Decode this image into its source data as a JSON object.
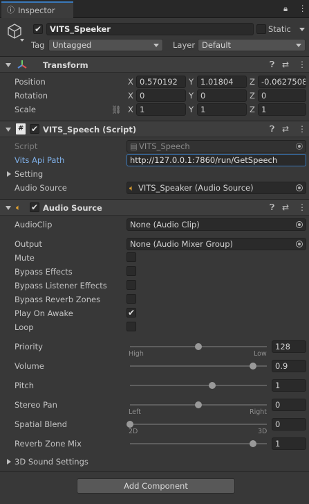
{
  "tab": {
    "label": "Inspector"
  },
  "object": {
    "name": "VITS_Speeker",
    "static_label": "Static",
    "tag_label": "Tag",
    "tag_value": "Untagged",
    "layer_label": "Layer",
    "layer_value": "Default"
  },
  "transform": {
    "title": "Transform",
    "position": {
      "label": "Position",
      "x": "0.570192",
      "y": "1.01804",
      "z": "-0.0627508"
    },
    "rotation": {
      "label": "Rotation",
      "x": "0",
      "y": "0",
      "z": "0"
    },
    "scale": {
      "label": "Scale",
      "x": "1",
      "y": "1",
      "z": "1"
    },
    "axis": {
      "x": "X",
      "y": "Y",
      "z": "Z"
    }
  },
  "script": {
    "title": "VITS_Speech (Script)",
    "script_label": "Script",
    "script_value": "VITS_Speech",
    "api_label": "Vits Api Path",
    "api_value": "http://127.0.0.1:7860/run/GetSpeech",
    "setting_label": "Setting",
    "audio_source_label": "Audio Source",
    "audio_source_value": "VITS_Speaker (Audio Source)"
  },
  "audio": {
    "title": "Audio Source",
    "clip_label": "AudioClip",
    "clip_value": "None (Audio Clip)",
    "output_label": "Output",
    "output_value": "None (Audio Mixer Group)",
    "mute": "Mute",
    "bypass_effects": "Bypass Effects",
    "bypass_listener": "Bypass Listener Effects",
    "bypass_reverb": "Bypass Reverb Zones",
    "play_on_awake": "Play On Awake",
    "loop": "Loop",
    "priority": {
      "label": "Priority",
      "value": "128",
      "min_label": "High",
      "max_label": "Low",
      "level": 0.5
    },
    "volume": {
      "label": "Volume",
      "value": "0.9",
      "level": 0.9
    },
    "pitch": {
      "label": "Pitch",
      "value": "1",
      "level": 0.6
    },
    "stereo_pan": {
      "label": "Stereo Pan",
      "value": "0",
      "min_label": "Left",
      "max_label": "Right",
      "level": 0.5
    },
    "spatial_blend": {
      "label": "Spatial Blend",
      "value": "0",
      "min_label": "2D",
      "max_label": "3D",
      "level": 0.0
    },
    "reverb_mix": {
      "label": "Reverb Zone Mix",
      "value": "1",
      "level": 0.9
    },
    "sound3d_label": "3D Sound Settings"
  },
  "add_component": "Add Component",
  "colors": {
    "link": "#7fb0e8",
    "background": "#383838",
    "accent": "#3a79bb"
  }
}
